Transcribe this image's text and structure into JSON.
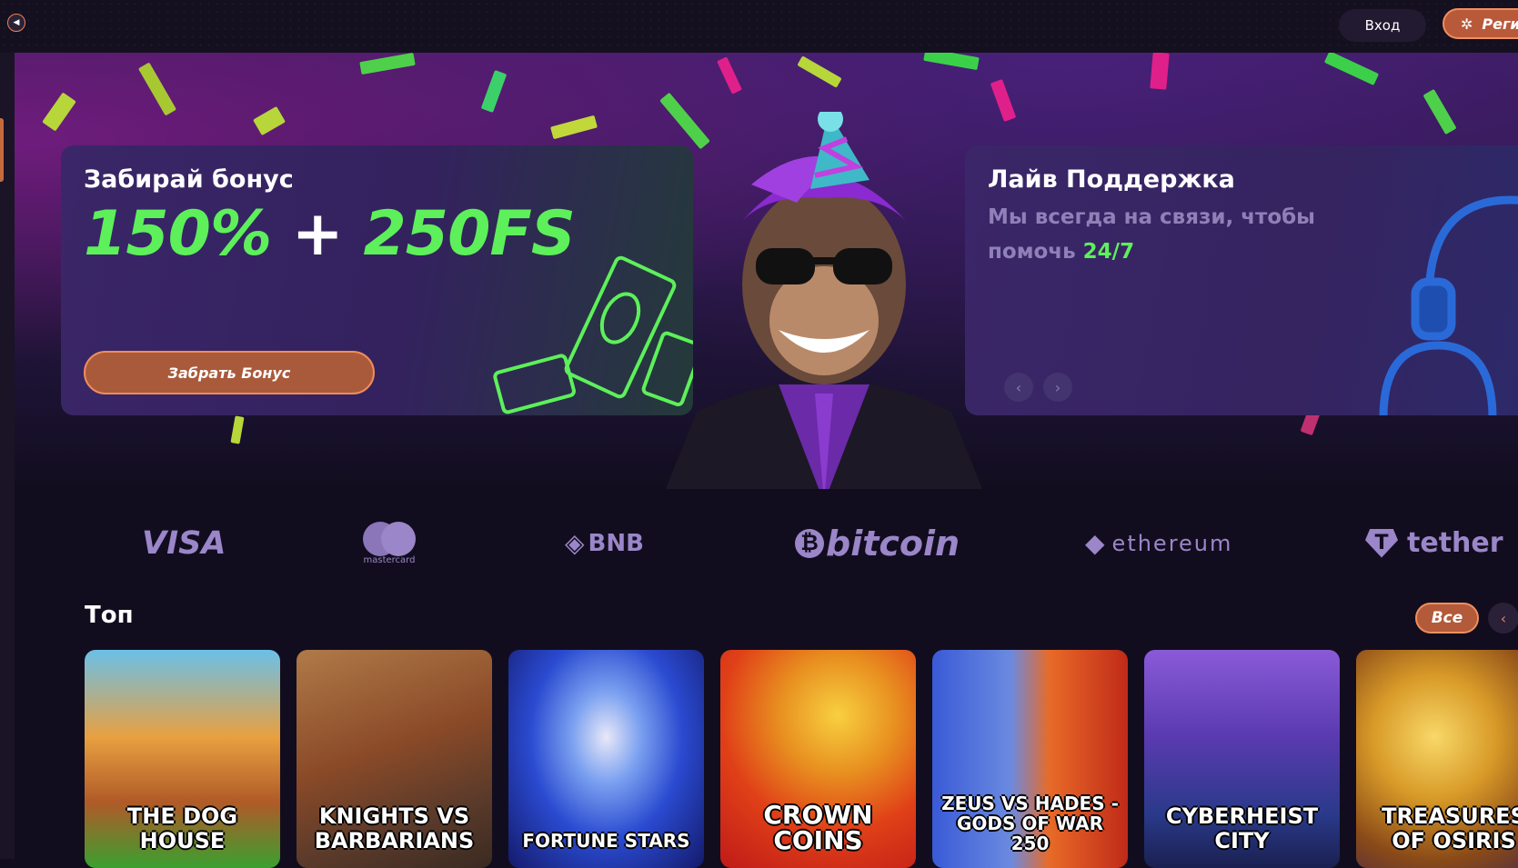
{
  "header": {
    "login_label": "Вход",
    "register_label": "Регистрация"
  },
  "hero": {
    "promo": {
      "title": "Забирай бонус",
      "offer_part1": "150%",
      "offer_plus": "+",
      "offer_part2": "250FS",
      "button_label": "Забрать Бонус"
    },
    "support": {
      "title": "Лайв Поддержка",
      "text": "Мы всегда на связи, чтобы помочь",
      "highlight": "24/7"
    },
    "slider": {
      "prev": "‹",
      "next": "›"
    }
  },
  "payments": {
    "visa": "VISA",
    "mastercard": "mastercard",
    "bnb": "BNB",
    "bitcoin": "bitcoin",
    "ethereum": "ethereum",
    "tether": "tether"
  },
  "top_section": {
    "title": "Топ",
    "all_label": "Все",
    "prev": "‹",
    "games": [
      {
        "name": "THE DOG HOUSE"
      },
      {
        "name": "KNIGHTS VS BARBARIANS"
      },
      {
        "name": "FORTUNE STARS"
      },
      {
        "name": "CROWN COINS"
      },
      {
        "name": "ZEUS VS HADES - GODS OF WAR 250"
      },
      {
        "name": "CYBERHEIST CITY"
      },
      {
        "name": "TREASURES OF OSIRIS"
      }
    ]
  },
  "colors": {
    "accent_green": "#5df05a",
    "accent_orange": "#f08c5a",
    "bg": "#120d1e"
  }
}
